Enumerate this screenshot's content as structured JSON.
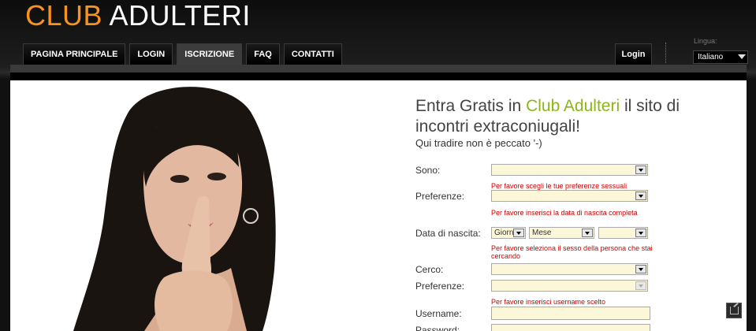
{
  "logo": {
    "part1": "CLUB",
    "part2": "ADULTERI"
  },
  "nav": {
    "items": [
      {
        "label": "PAGINA PRINCIPALE"
      },
      {
        "label": "LOGIN"
      },
      {
        "label": "ISCRIZIONE",
        "active": true
      },
      {
        "label": "FAQ"
      },
      {
        "label": "CONTATTI"
      }
    ]
  },
  "header": {
    "login_label": "Login",
    "lingua_label": "Lingua:",
    "language": "Italiano"
  },
  "hero": {
    "headline_pre": "Entra Gratis in ",
    "headline_brand": "Club Adulteri",
    "headline_post": " il sito di incontri extraconiugali!",
    "subline": "Qui tradire non è peccato '-)"
  },
  "form": {
    "sono_label": "Sono:",
    "sono_value": "",
    "error_preferenze": "Per favore scegli le tue preferenze sessuali",
    "preferenze_label": "Preferenze:",
    "preferenze_value": "",
    "error_nascita": "Per favore inserisci la data di nascita completa",
    "nascita_label": "Data di nascita:",
    "giorno_value": "Giorno",
    "mese_value": "Mese",
    "anno_value": "",
    "error_cerco": "Per favore seleziona il sesso della persona che stai cercando",
    "cerco_label": "Cerco:",
    "cerco_value": "",
    "preferenze2_label": "Preferenze:",
    "preferenze2_value": "",
    "error_username": "Per favore inserisci username scelto",
    "username_label": "Username:",
    "username_value": "",
    "password_label": "Password:",
    "password_value": ""
  },
  "colors": {
    "brand_orange": "#f7931e",
    "accent_green": "#8cb51a",
    "error_red": "#d00000",
    "field_bg": "#fdf7d9"
  }
}
